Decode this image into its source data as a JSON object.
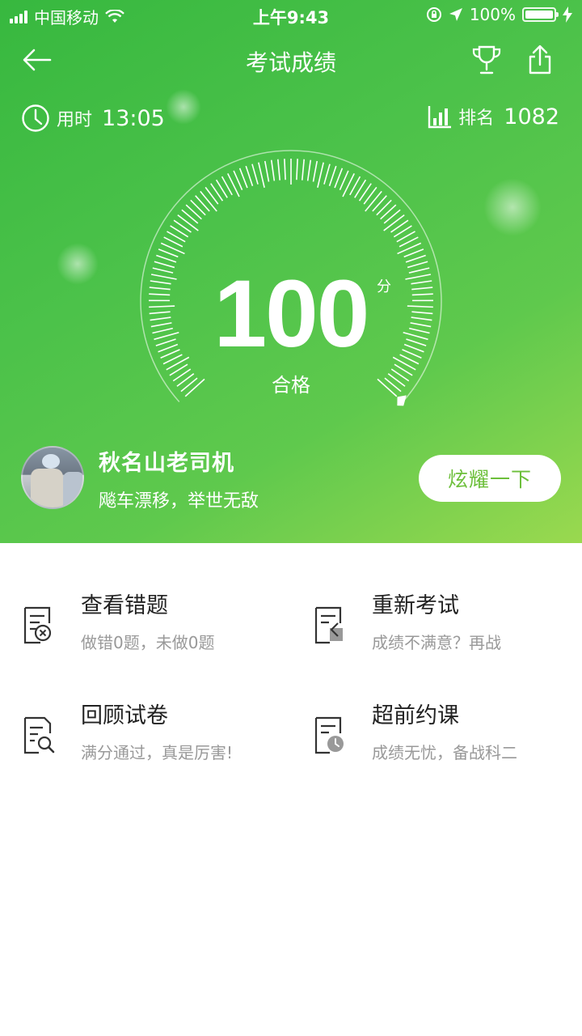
{
  "status_bar": {
    "carrier": "中国移动",
    "time": "上午9:43",
    "battery": "100%"
  },
  "nav": {
    "title": "考试成绩",
    "back_icon": "arrow-left-icon",
    "trophy_icon": "trophy-icon",
    "share_icon": "share-icon"
  },
  "stats": {
    "duration_label": "用时",
    "duration_value": "13:05",
    "rank_label": "排名",
    "rank_value": "1082"
  },
  "result": {
    "score": "100",
    "unit": "分",
    "level": "合格",
    "gauge_fraction": 1.0
  },
  "user": {
    "name": "秋名山老司机",
    "motto": "飚车漂移，举世无敌",
    "show_button": "炫耀一下"
  },
  "actions": [
    {
      "title": "查看错题",
      "subtitle": "做错0题，未做0题",
      "icon": "wrong-answers-icon"
    },
    {
      "title": "重新考试",
      "subtitle": "成绩不满意？再战",
      "icon": "retake-exam-icon"
    },
    {
      "title": "回顾试卷",
      "subtitle": "满分通过，真是厉害!",
      "icon": "review-paper-icon"
    },
    {
      "title": "超前约课",
      "subtitle": "成绩无忧，备战科二",
      "icon": "book-class-icon"
    }
  ],
  "colors": {
    "hero_green": "#4cc24a",
    "button_text": "#6cbf3a"
  }
}
